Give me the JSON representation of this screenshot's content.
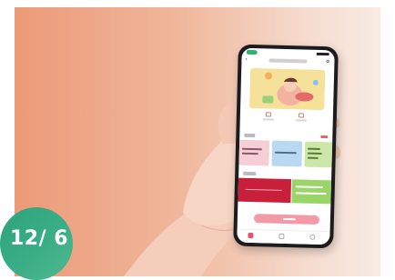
{
  "badge": {
    "text": "12/ 6",
    "color": "#33a67f"
  },
  "banner": {
    "gradient_start": "#ec9a78",
    "gradient_end": "#f9ebe4"
  },
  "phone": {
    "accent_color": "#2fb36a",
    "cta_color": "#f29aa6",
    "promo_red": "#c81f3b",
    "promo_green": "#9bd469"
  },
  "icons": [
    "back-arrow-icon",
    "settings-icon",
    "home-tab-icon",
    "search-tab-icon",
    "profile-tab-icon"
  ]
}
